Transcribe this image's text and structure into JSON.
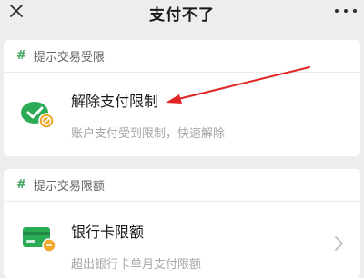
{
  "header": {
    "title": "支付不了",
    "close_icon": "close-icon",
    "more_icon": "more-dots-icon"
  },
  "sections": [
    {
      "label": "提示交易受限",
      "hash": "#",
      "row": {
        "title": "解除支付限制",
        "subtitle": "账户支付受到限制，快速解除",
        "icon": "wechat-pay-restricted-icon"
      }
    },
    {
      "label": "提示交易限额",
      "hash": "#",
      "row": {
        "title": "银行卡限额",
        "subtitle": "超出银行卡单月支付限额",
        "icon": "bank-card-icon"
      }
    }
  ],
  "colors": {
    "accent_green": "#3fa55a",
    "annotation_red": "#e02424",
    "background": "#ededed"
  }
}
